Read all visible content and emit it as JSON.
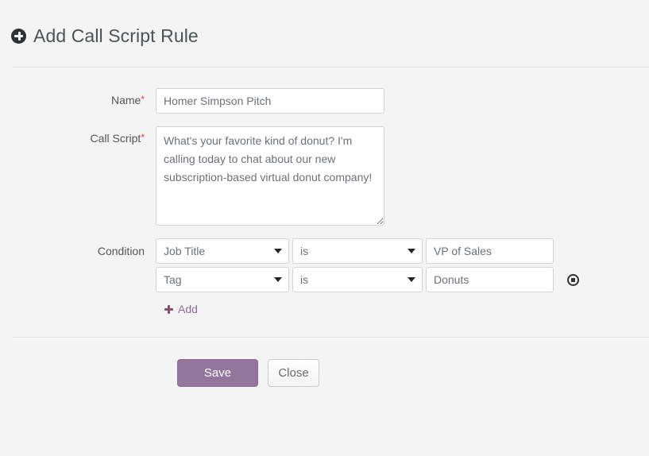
{
  "header": {
    "title": "Add Call Script Rule",
    "icon": "plus-circle-icon"
  },
  "form": {
    "name": {
      "label": "Name",
      "required_marker": "*",
      "value": "Homer Simpson Pitch",
      "placeholder": ""
    },
    "call_script": {
      "label": "Call Script",
      "required_marker": "*",
      "value": "What's your favorite kind of donut? I'm calling today to chat about our new subscription-based virtual donut company!",
      "placeholder": ""
    },
    "condition": {
      "label": "Condition",
      "rows": [
        {
          "field": "Job Title",
          "operator": "is",
          "value": "VP of Sales",
          "has_remove": false
        },
        {
          "field": "Tag",
          "operator": "is",
          "value": "Donuts",
          "has_remove": true
        }
      ],
      "add_label": "Add",
      "add_icon": "plus-icon",
      "remove_icon": "remove-circle-icon"
    }
  },
  "footer": {
    "save_label": "Save",
    "close_label": "Close"
  },
  "colors": {
    "accent_purple": "#94759b",
    "link_purple": "#8f6d96",
    "required_red": "#d9413c",
    "page_background": "#f4f4f4",
    "divider": "#e4e4e4"
  }
}
